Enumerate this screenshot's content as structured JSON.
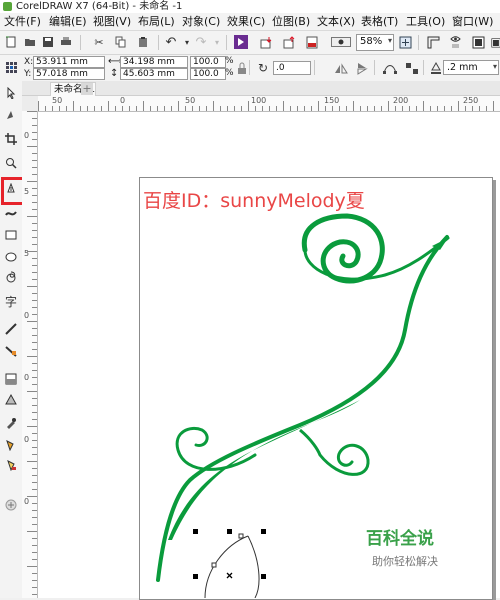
{
  "window": {
    "title": "CorelDRAW X7 (64-Bit) - 未命名 -1"
  },
  "menu": [
    "文件(F)",
    "编辑(E)",
    "视图(V)",
    "布局(L)",
    "对象(C)",
    "效果(C)",
    "位图(B)",
    "文本(X)",
    "表格(T)",
    "工具(O)",
    "窗口(W)"
  ],
  "toolbar": {
    "zoom": "58%"
  },
  "properties": {
    "x_label": "X:",
    "x": "53.911 mm",
    "y_label": "Y:",
    "y": "57.018 mm",
    "width": "34.198 mm",
    "height": "45.603 mm",
    "scale_x": "100.0",
    "scale_y": "100.0",
    "percent": "%",
    "rotation": ".0",
    "outline_width": ".2 mm"
  },
  "tab": {
    "name": "未命名 -1",
    "add": "+"
  },
  "ruler": {
    "h": [
      "50",
      "0",
      "50",
      "100",
      "150",
      "200",
      "250"
    ],
    "v": [
      "0",
      "5",
      "5",
      "0",
      "0",
      "0",
      "0"
    ]
  },
  "watermark": {
    "baidu": "百度ID：sunnyMelody夏",
    "brand": "百科全说",
    "slogan": "助你轻松解决"
  },
  "colors": {
    "accent_green": "#0a9b3c",
    "highlight_red": "#e6232a"
  }
}
